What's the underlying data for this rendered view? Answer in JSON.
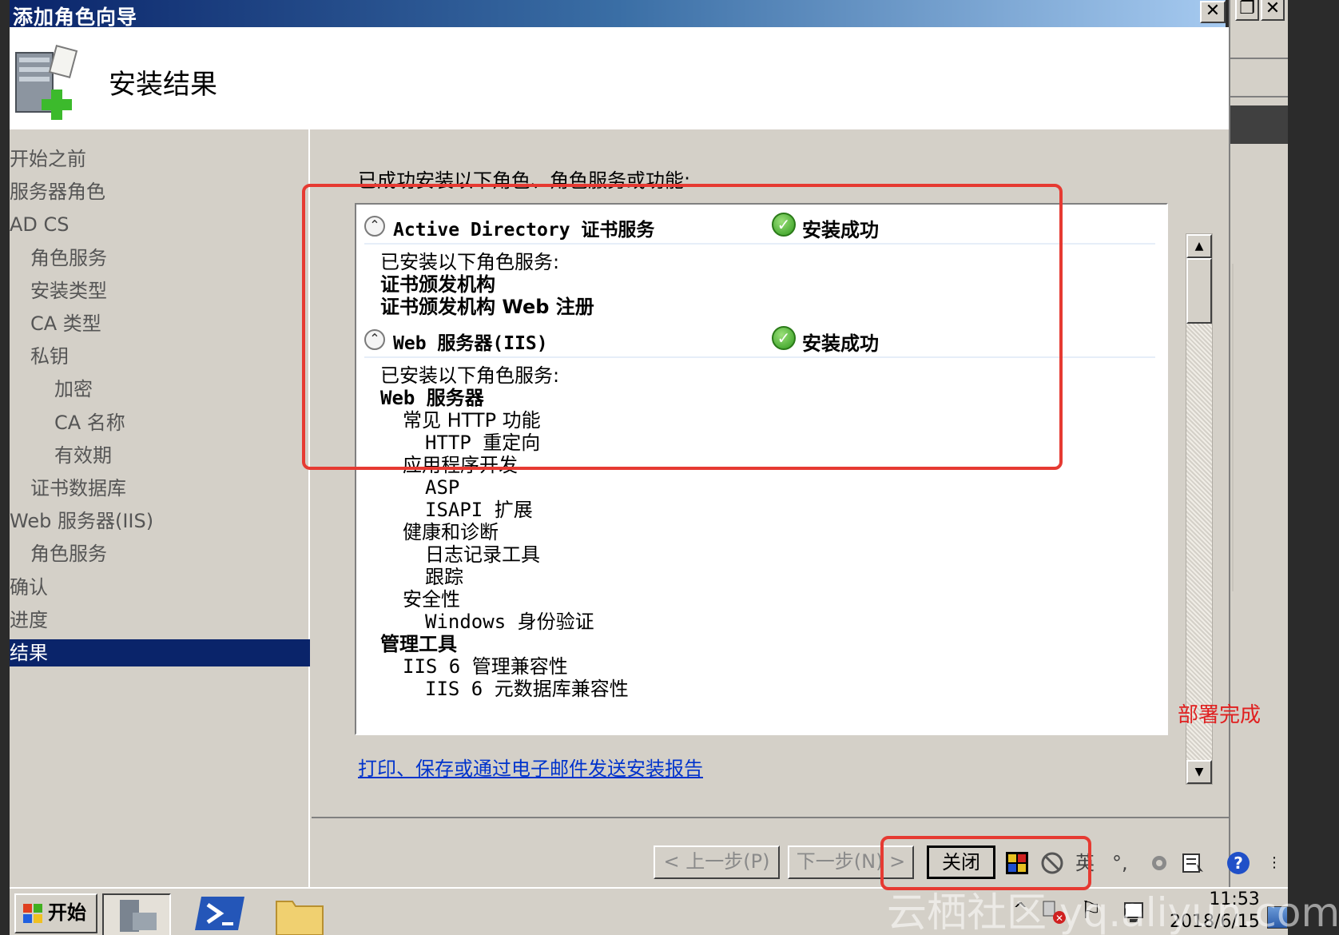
{
  "window": {
    "title": "添加角色向导",
    "buttons": {
      "close_glyph": "✕",
      "restore_glyph": "❐",
      "close2_glyph": "✕"
    }
  },
  "header": {
    "title": "安装结果",
    "icon": "server-add-icon"
  },
  "nav": {
    "items": [
      {
        "label": "开始之前",
        "level": 0,
        "active": false
      },
      {
        "label": "服务器角色",
        "level": 0,
        "active": false
      },
      {
        "label": "AD CS",
        "level": 0,
        "active": false
      },
      {
        "label": "角色服务",
        "level": 1,
        "active": false
      },
      {
        "label": "安装类型",
        "level": 1,
        "active": false
      },
      {
        "label": "CA 类型",
        "level": 1,
        "active": false
      },
      {
        "label": "私钥",
        "level": 1,
        "active": false
      },
      {
        "label": "加密",
        "level": 2,
        "active": false
      },
      {
        "label": "CA 名称",
        "level": 2,
        "active": false
      },
      {
        "label": "有效期",
        "level": 2,
        "active": false
      },
      {
        "label": "证书数据库",
        "level": 1,
        "active": false
      },
      {
        "label": "Web 服务器(IIS)",
        "level": 0,
        "active": false
      },
      {
        "label": "角色服务",
        "level": 1,
        "active": false
      },
      {
        "label": "确认",
        "level": 0,
        "active": false
      },
      {
        "label": "进度",
        "level": 0,
        "active": false
      },
      {
        "label": "结果",
        "level": 0,
        "active": true
      }
    ]
  },
  "content": {
    "lead": "已成功安装以下角色、角色服务或功能:",
    "roles": [
      {
        "name": "Active Directory 证书服务",
        "status": "安装成功",
        "details_header": "已安装以下角色服务:",
        "lines": [
          {
            "text": "证书颁发机构",
            "indent": 0,
            "bold": true
          },
          {
            "text": "证书颁发机构 Web 注册",
            "indent": 0,
            "bold": true
          }
        ]
      },
      {
        "name": "Web 服务器(IIS)",
        "status": "安装成功",
        "details_header": "已安装以下角色服务:",
        "lines": [
          {
            "text": "Web 服务器",
            "indent": 0,
            "bold": true
          },
          {
            "text": "常见 HTTP 功能",
            "indent": 1,
            "bold": false
          },
          {
            "text": "HTTP 重定向",
            "indent": 2,
            "bold": false
          },
          {
            "text": "应用程序开发",
            "indent": 1,
            "bold": false
          },
          {
            "text": "ASP",
            "indent": 2,
            "bold": false
          },
          {
            "text": "ISAPI 扩展",
            "indent": 2,
            "bold": false
          },
          {
            "text": "健康和诊断",
            "indent": 1,
            "bold": false
          },
          {
            "text": "日志记录工具",
            "indent": 2,
            "bold": false
          },
          {
            "text": "跟踪",
            "indent": 2,
            "bold": false
          },
          {
            "text": "安全性",
            "indent": 1,
            "bold": false
          },
          {
            "text": "Windows 身份验证",
            "indent": 2,
            "bold": false
          },
          {
            "text": "管理工具",
            "indent": 0,
            "bold": true
          },
          {
            "text": "IIS 6 管理兼容性",
            "indent": 1,
            "bold": false
          },
          {
            "text": "IIS 6 元数据库兼容性",
            "indent": 2,
            "bold": false
          }
        ]
      }
    ],
    "report_link": "打印、保存或通过电子邮件发送安装报告",
    "annotation": "部署完成"
  },
  "buttons": {
    "prev": "< 上一步(P)",
    "next": "下一步(N) >",
    "close": "关闭"
  },
  "ime": {
    "lang": "英",
    "punct": "°,",
    "icons": [
      "ime-logo-icon",
      "no-entry-icon",
      "tools-icon",
      "keyboard-icon",
      "help-icon"
    ]
  },
  "taskbar": {
    "start": "开始",
    "clock_time": "11:53",
    "clock_date": "2018/6/15"
  },
  "watermark": "云栖社区 yq.aliyun.com",
  "colors": {
    "annotation": "#e63a32",
    "selection": "#0a246a",
    "link": "#0033cc",
    "success": "#2f9a1c"
  }
}
